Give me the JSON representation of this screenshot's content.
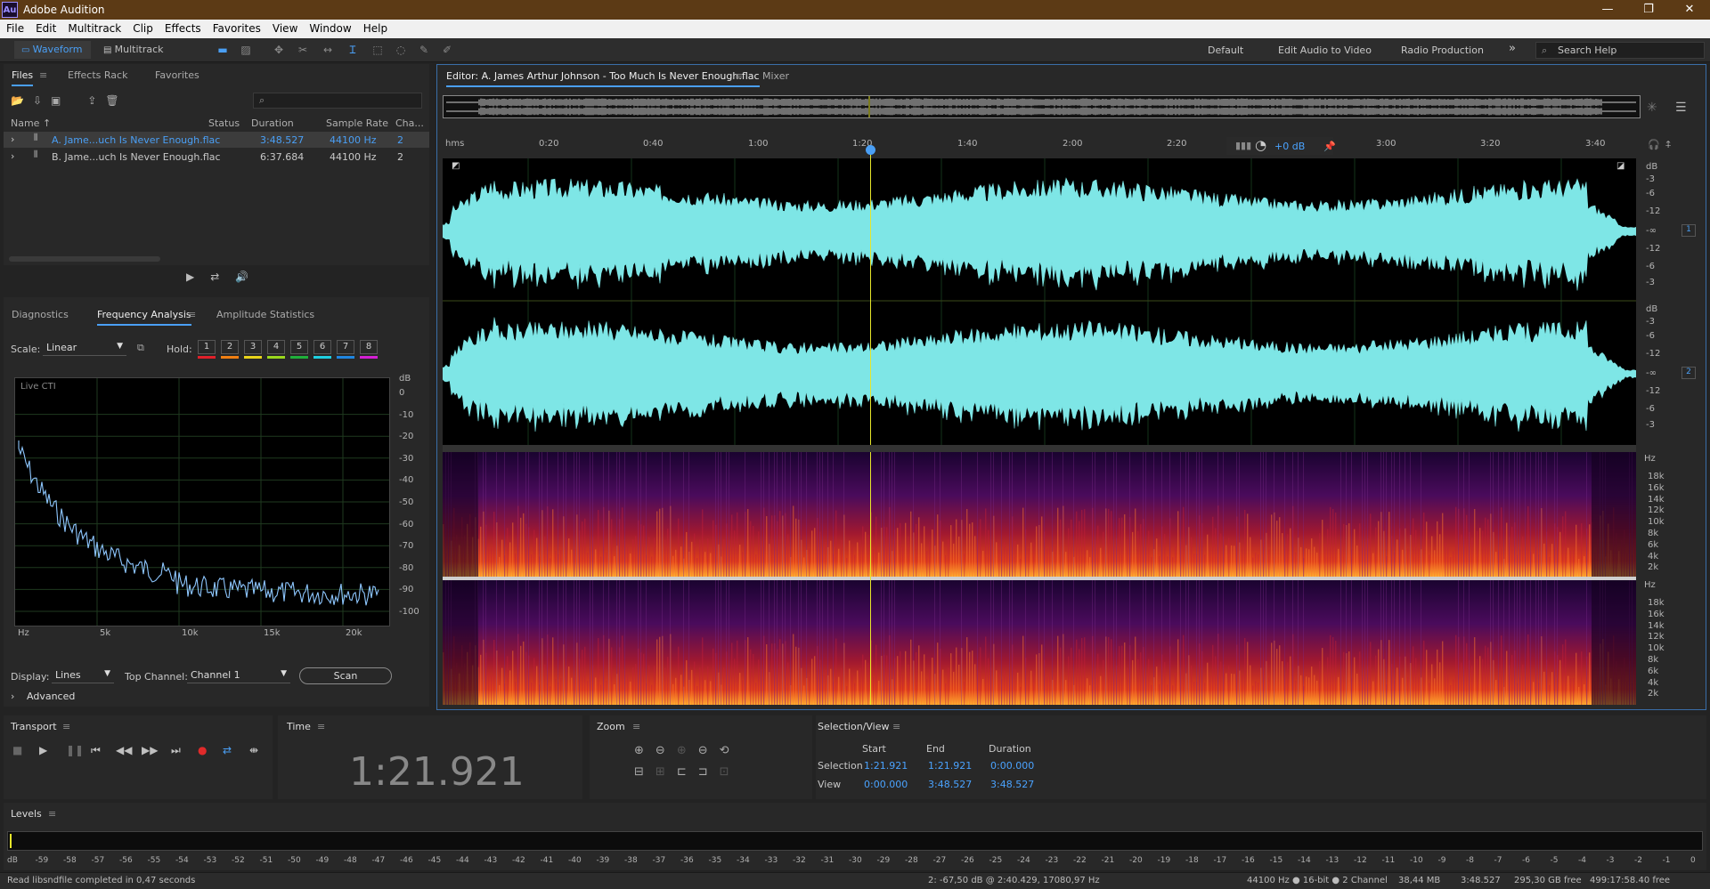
{
  "app": {
    "title": "Adobe Audition",
    "logo": "Au"
  },
  "window_controls": [
    "—",
    "❐",
    "✕"
  ],
  "menu": [
    "File",
    "Edit",
    "Multitrack",
    "Clip",
    "Effects",
    "Favorites",
    "View",
    "Window",
    "Help"
  ],
  "toolbar": {
    "waveform": "Waveform",
    "multitrack": "Multitrack",
    "workspaces": [
      "Default",
      "Edit Audio to Video",
      "Radio Production"
    ],
    "more": "»",
    "search_placeholder": "Search Help"
  },
  "files_panel": {
    "tabs": [
      "Files",
      "Effects Rack",
      "Favorites"
    ],
    "columns": [
      "Name ↑",
      "Status",
      "Duration",
      "Sample Rate",
      "Cha..."
    ],
    "rows": [
      {
        "name": "A. Jame...uch Is Never Enough.flac",
        "status": "",
        "duration": "3:48.527",
        "rate": "44100 Hz",
        "ch": "2"
      },
      {
        "name": "B. Jame...uch Is Never Enough.flac",
        "status": "",
        "duration": "6:37.684",
        "rate": "44100 Hz",
        "ch": "2"
      }
    ],
    "search_icon": "⌕"
  },
  "analysis_panel": {
    "tabs": [
      "Diagnostics",
      "Frequency Analysis",
      "Amplitude Statistics"
    ],
    "scale_label": "Scale:",
    "scale_value": "Linear",
    "hold_label": "Hold:",
    "hold": [
      "1",
      "2",
      "3",
      "4",
      "5",
      "6",
      "7",
      "8"
    ],
    "hold_colors": [
      "#e0202a",
      "#f07f12",
      "#e8d41a",
      "#9ad81d",
      "#1fb03a",
      "#1ecfe0",
      "#1f86e0",
      "#d41fd4"
    ],
    "chart_legend": "Live CTI",
    "db_unit": "dB",
    "db_ticks": [
      "0",
      "-10",
      "-20",
      "-30",
      "-40",
      "-50",
      "-60",
      "-70",
      "-80",
      "-90",
      "-100"
    ],
    "freq_ticks": [
      "Hz",
      "5k",
      "10k",
      "15k",
      "20k"
    ],
    "display_label": "Display:",
    "display_value": "Lines",
    "top_channel_label": "Top Channel:",
    "top_channel_value": "Channel 1",
    "scan_label": "Scan",
    "advanced_label": "Advanced"
  },
  "editor": {
    "tab": "Editor: A. James Arthur Johnson - Too Much Is Never Enough.flac",
    "mixer_tab": "Mixer",
    "time_ticks": [
      "hms",
      "0:20",
      "0:40",
      "1:00",
      "1:20",
      "1:40",
      "2:00",
      "2:20",
      "3:00",
      "3:20",
      "3:40"
    ],
    "volume": "+0 dB",
    "db_scale": [
      "dB",
      "-3",
      "-6",
      "-12",
      "-∞",
      "-12",
      "-6",
      "-3"
    ],
    "channels": [
      "1",
      "2"
    ],
    "hz_unit": "Hz",
    "hz_scale": [
      "18k",
      "16k",
      "14k",
      "12k",
      "10k",
      "8k",
      "6k",
      "4k",
      "2k"
    ]
  },
  "transport": {
    "title": "Transport",
    "buttons": [
      "■",
      "▶",
      "❚❚",
      "⏮",
      "◀◀",
      "▶▶",
      "⏭",
      "●",
      "⇄",
      "⇼"
    ]
  },
  "time_panel": {
    "title": "Time",
    "value": "1:21.921"
  },
  "zoom_panel": {
    "title": "Zoom"
  },
  "selection_panel": {
    "title": "Selection/View",
    "headers": [
      "Start",
      "End",
      "Duration"
    ],
    "selection": {
      "label": "Selection",
      "start": "1:21.921",
      "end": "1:21.921",
      "duration": "0:00.000"
    },
    "view": {
      "label": "View",
      "start": "0:00.000",
      "end": "3:48.527",
      "duration": "3:48.527"
    }
  },
  "levels": {
    "title": "Levels",
    "ticks": [
      "dB",
      "-59",
      "-58",
      "-57",
      "-56",
      "-55",
      "-54",
      "-53",
      "-52",
      "-51",
      "-50",
      "-49",
      "-48",
      "-47",
      "-46",
      "-45",
      "-44",
      "-43",
      "-42",
      "-41",
      "-40",
      "-39",
      "-38",
      "-37",
      "-36",
      "-35",
      "-34",
      "-33",
      "-32",
      "-31",
      "-30",
      "-29",
      "-28",
      "-27",
      "-26",
      "-25",
      "-24",
      "-23",
      "-22",
      "-21",
      "-20",
      "-19",
      "-18",
      "-17",
      "-16",
      "-15",
      "-14",
      "-13",
      "-12",
      "-11",
      "-10",
      "-9",
      "-8",
      "-7",
      "-6",
      "-5",
      "-4",
      "-3",
      "-2",
      "-1",
      "0"
    ]
  },
  "status": {
    "left": "Read libsndfile completed in 0,47 seconds",
    "cursor": "2: -67,50 dB @ 2:40.429, 17080,97 Hz",
    "format": "44100 Hz ● 16-bit ● 2 Channel",
    "size": "38,44 MB",
    "duration": "3:48.527",
    "free": "295,30 GB free",
    "time_free": "499:17:58.40 free"
  },
  "colors": {
    "wave": "#7ee6e6",
    "accent": "#4a9ff5",
    "playhead": "#e6e62a"
  }
}
